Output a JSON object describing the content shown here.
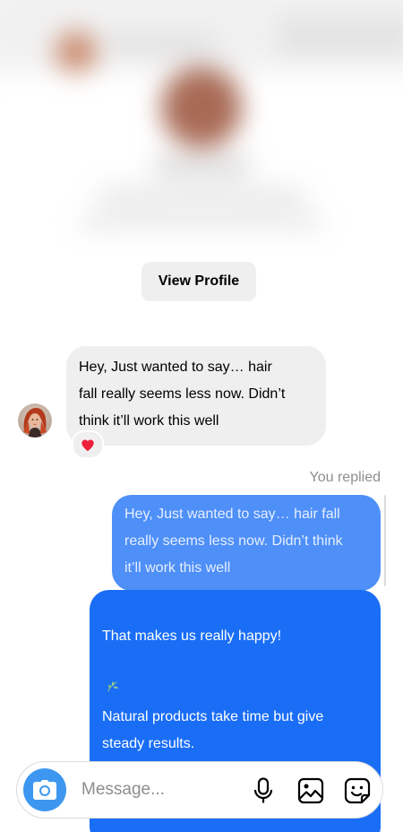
{
  "profile": {
    "view_profile_label": "View Profile"
  },
  "incoming": {
    "text": "Hey, Just wanted to say… hair\nfall really seems less now. Didn’t\nthink it’ll work this well",
    "reaction": "❤️"
  },
  "reply_context": {
    "label": "You replied",
    "quoted_text": "Hey, Just wanted to say… hair fall\nreally seems less now. Didn’t think\nit’ll work this well"
  },
  "outgoing": {
    "line1": "That makes us really happy!",
    "emoji": "🌿",
    "rest": "Natural products take time but give\nsteady results.\nKeep going — we’re here if you need\nhelp"
  },
  "composer": {
    "placeholder": "Message...",
    "value": ""
  },
  "colors": {
    "incoming_bubble": "#efefef",
    "quoted_bubble": "#4e8ff8",
    "outgoing_bubble": "#1a6ef6",
    "camera_button": "#3d97f0"
  },
  "icons": {
    "camera": "camera-icon",
    "mic": "microphone-icon",
    "gallery": "image-icon",
    "sticker": "sticker-icon",
    "reaction": "heart-icon"
  }
}
